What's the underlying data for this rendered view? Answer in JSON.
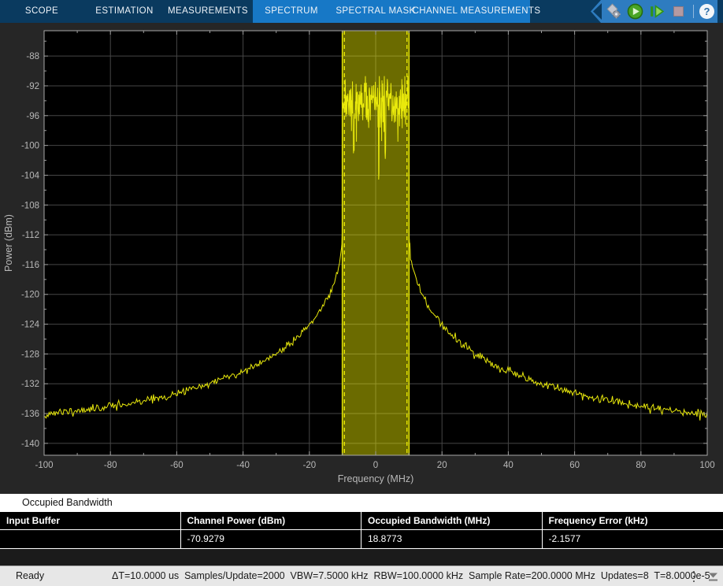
{
  "toolbar": {
    "tabs": [
      {
        "label": "SCOPE",
        "contextual": false
      },
      {
        "label": "ESTIMATION",
        "contextual": false
      },
      {
        "label": "MEASUREMENTS",
        "contextual": false
      },
      {
        "label": "SPECTRUM",
        "contextual": true
      },
      {
        "label": "SPECTRAL MASK",
        "contextual": true
      },
      {
        "label": "CHANNEL MEASUREMENTS",
        "contextual": true
      }
    ],
    "icons": {
      "collapse": "collapse-toolstrip-arrow",
      "settings": "processing-options-gear",
      "run": "run-play",
      "step_forward": "step-forward",
      "stop": "stop-disabled",
      "help_glyph": "?"
    },
    "colors": {
      "bar": "#0a3a5f",
      "contextual": "#1778c6",
      "banner": "#2e7cc0"
    }
  },
  "chart_data": {
    "type": "line",
    "title": "",
    "xlabel": "Frequency (MHz)",
    "ylabel": "Power (dBm)",
    "xlim": [
      -100,
      100
    ],
    "ylim": [
      -141.6,
      -84.6
    ],
    "xticks": [
      -100,
      -80,
      -60,
      -40,
      -20,
      0,
      20,
      40,
      60,
      80,
      100
    ],
    "yticks": [
      -140,
      -136,
      -132,
      -128,
      -124,
      -120,
      -116,
      -112,
      -108,
      -104,
      -100,
      -96,
      -92,
      -88
    ],
    "x_minor_step": 10,
    "y_minor_step": 2,
    "grid": true,
    "background": "#000000",
    "figure_background": "#262626",
    "trace_color": "#e9e90c",
    "grid_color": "#464646",
    "axis_color": "#a8a8a8",
    "label_color": "#b8b8b8",
    "band": {
      "fill_range_MHz": [
        -10.07,
        10.07
      ],
      "fill_color": "rgba(255,255,0,0.42)",
      "edge_color": "#e3e308",
      "obw_lines_MHz": [
        -9.4386,
        9.4386
      ],
      "obw_line_color": "#f0f000",
      "obw_dash": [
        5,
        4
      ]
    },
    "passband_noise": {
      "range_MHz": [
        -10,
        10
      ],
      "mean_dBm": -94.3,
      "stddev_dB": 1.7,
      "min_dBm": -99.5,
      "max_dBm": -90.7,
      "dips": [
        {
          "f_MHz": -6.6,
          "p_dBm": -100.6
        },
        {
          "f_MHz": 0.95,
          "p_dBm": -104.4
        },
        {
          "f_MHz": 2.9,
          "p_dBm": -100.9
        }
      ]
    },
    "tail_anchors_MHz_dBm": [
      [
        10.0,
        -96
      ],
      [
        10.08,
        -112
      ],
      [
        10.5,
        -114.8
      ],
      [
        11,
        -116.2
      ],
      [
        12,
        -117.8
      ],
      [
        13,
        -119
      ],
      [
        14.7,
        -120.6
      ],
      [
        17,
        -122.4
      ],
      [
        20,
        -124.1
      ],
      [
        23,
        -125.5
      ],
      [
        26,
        -126.6
      ],
      [
        30,
        -128
      ],
      [
        35,
        -129.3
      ],
      [
        40,
        -130.3
      ],
      [
        45,
        -131.2
      ],
      [
        50,
        -132
      ],
      [
        55,
        -132.7
      ],
      [
        60,
        -133.3
      ],
      [
        65,
        -133.9
      ],
      [
        70,
        -134.3
      ],
      [
        75,
        -134.7
      ],
      [
        80,
        -135
      ],
      [
        85,
        -135.3
      ],
      [
        90,
        -135.6
      ],
      [
        95,
        -135.85
      ],
      [
        100,
        -136.1
      ]
    ],
    "noise_seed": 11,
    "measurements": {
      "channel_power_dBm": -70.9279,
      "occupied_bandwidth_MHz": 18.8773,
      "frequency_error_kHz": -2.1577
    }
  },
  "panel": {
    "title": "Occupied Bandwidth"
  },
  "table": {
    "header": [
      "Input Buffer",
      "Channel Power (dBm)",
      "Occupied Bandwidth (MHz)",
      "Frequency Error (kHz)"
    ],
    "rows": [
      [
        "",
        "-70.9279",
        "18.8773",
        "-2.1577"
      ]
    ]
  },
  "statusbar": {
    "state": "Ready",
    "stats": [
      "ΔT=10.0000 us",
      "Samples/Update=2000",
      "VBW=7.5000 kHz",
      "RBW=100.0000 kHz",
      "Sample Rate=200.0000 MHz",
      "Updates=8",
      "T=8.0000e-5"
    ]
  }
}
